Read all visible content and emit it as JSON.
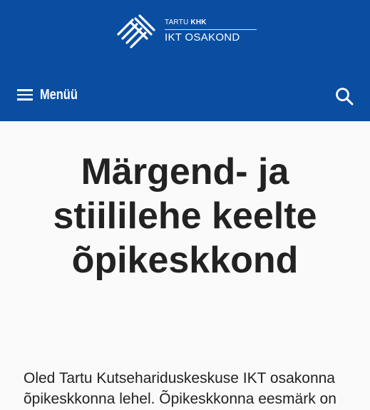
{
  "header": {
    "background_color": "#0a4ea2",
    "logo": {
      "top_prefix": "TARTU",
      "top_bold": "KHK",
      "bottom_text": "IKT OSAKOND"
    },
    "menu_label": "Menüü",
    "menu_icon": "hamburger-icon",
    "search_icon": "search-icon"
  },
  "main": {
    "title_lines": [
      "Märgend- ja",
      "stiililehe keelte",
      "õpikeskkond"
    ],
    "intro_lines": [
      "Oled Tartu Kutsehariduskeskuse IKT osakonna",
      "õpikeskkonna lehel. Õpikeskkonna eesmärk on"
    ]
  }
}
